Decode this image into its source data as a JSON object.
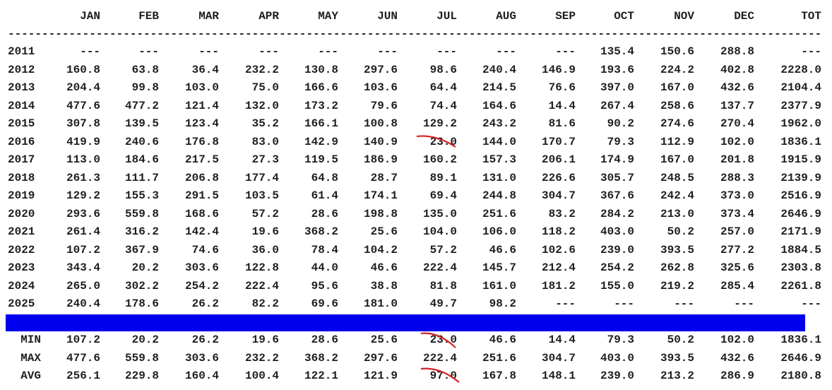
{
  "headers": [
    "JAN",
    "FEB",
    "MAR",
    "APR",
    "MAY",
    "JUN",
    "JUL",
    "AUG",
    "SEP",
    "OCT",
    "NOV",
    "DEC",
    "TOT"
  ],
  "separator": "------------------------------------------------------------------------------------------------------------------------------------------------------------",
  "rows": [
    {
      "year": "2011",
      "values": [
        "---",
        "---",
        "---",
        "---",
        "---",
        "---",
        "---",
        "---",
        "---",
        "135.4",
        "150.6",
        "288.8",
        "---"
      ]
    },
    {
      "year": "2012",
      "values": [
        "160.8",
        "63.8",
        "36.4",
        "232.2",
        "130.8",
        "297.6",
        "98.6",
        "240.4",
        "146.9",
        "193.6",
        "224.2",
        "402.8",
        "2228.0"
      ]
    },
    {
      "year": "2013",
      "values": [
        "204.4",
        "99.8",
        "103.0",
        "75.0",
        "166.6",
        "103.6",
        "64.4",
        "214.5",
        "76.6",
        "397.0",
        "167.0",
        "432.6",
        "2104.4"
      ]
    },
    {
      "year": "2014",
      "values": [
        "477.6",
        "477.2",
        "121.4",
        "132.0",
        "173.2",
        "79.6",
        "74.4",
        "164.6",
        "14.4",
        "267.4",
        "258.6",
        "137.7",
        "2377.9"
      ]
    },
    {
      "year": "2015",
      "values": [
        "307.8",
        "139.5",
        "123.4",
        "35.2",
        "166.1",
        "100.8",
        "129.2",
        "243.2",
        "81.6",
        "90.2",
        "274.6",
        "270.4",
        "1962.0"
      ]
    },
    {
      "year": "2016",
      "values": [
        "419.9",
        "240.6",
        "176.8",
        "83.0",
        "142.9",
        "140.9",
        "23.0",
        "144.0",
        "170.7",
        "79.3",
        "112.9",
        "102.0",
        "1836.1"
      ]
    },
    {
      "year": "2017",
      "values": [
        "113.0",
        "184.6",
        "217.5",
        "27.3",
        "119.5",
        "186.9",
        "160.2",
        "157.3",
        "206.1",
        "174.9",
        "167.0",
        "201.8",
        "1915.9"
      ]
    },
    {
      "year": "2018",
      "values": [
        "261.3",
        "111.7",
        "206.8",
        "177.4",
        "64.8",
        "28.7",
        "89.1",
        "131.0",
        "226.6",
        "305.7",
        "248.5",
        "288.3",
        "2139.9"
      ]
    },
    {
      "year": "2019",
      "values": [
        "129.2",
        "155.3",
        "291.5",
        "103.5",
        "61.4",
        "174.1",
        "69.4",
        "244.8",
        "304.7",
        "367.6",
        "242.4",
        "373.0",
        "2516.9"
      ]
    },
    {
      "year": "2020",
      "values": [
        "293.6",
        "559.8",
        "168.6",
        "57.2",
        "28.6",
        "198.8",
        "135.0",
        "251.6",
        "83.2",
        "284.2",
        "213.0",
        "373.4",
        "2646.9"
      ]
    },
    {
      "year": "2021",
      "values": [
        "261.4",
        "316.2",
        "142.4",
        "19.6",
        "368.2",
        "25.6",
        "104.0",
        "106.0",
        "118.2",
        "403.0",
        "50.2",
        "257.0",
        "2171.9"
      ]
    },
    {
      "year": "2022",
      "values": [
        "107.2",
        "367.9",
        "74.6",
        "36.0",
        "78.4",
        "104.2",
        "57.2",
        "46.6",
        "102.6",
        "239.0",
        "393.5",
        "277.2",
        "1884.5"
      ]
    },
    {
      "year": "2023",
      "values": [
        "343.4",
        "20.2",
        "303.6",
        "122.8",
        "44.0",
        "46.6",
        "222.4",
        "145.7",
        "212.4",
        "254.2",
        "262.8",
        "325.6",
        "2303.8"
      ]
    },
    {
      "year": "2024",
      "values": [
        "265.0",
        "302.2",
        "254.2",
        "222.4",
        "95.6",
        "38.8",
        "81.8",
        "161.0",
        "181.2",
        "155.0",
        "219.2",
        "285.4",
        "2261.8"
      ]
    },
    {
      "year": "2025",
      "values": [
        "240.4",
        "178.6",
        "26.2",
        "82.2",
        "69.6",
        "181.0",
        "49.7",
        "98.2",
        "---",
        "---",
        "---",
        "---",
        "---"
      ]
    }
  ],
  "stats": [
    {
      "label": "MIN",
      "values": [
        "107.2",
        "20.2",
        "26.2",
        "19.6",
        "28.6",
        "25.6",
        "23.0",
        "46.6",
        "14.4",
        "79.3",
        "50.2",
        "102.0",
        "1836.1"
      ]
    },
    {
      "label": "MAX",
      "values": [
        "477.6",
        "559.8",
        "303.6",
        "232.2",
        "368.2",
        "297.6",
        "222.4",
        "251.6",
        "304.7",
        "403.0",
        "393.5",
        "432.6",
        "2646.9"
      ]
    },
    {
      "label": "AVG",
      "values": [
        "256.1",
        "229.8",
        "160.4",
        "100.4",
        "122.1",
        "121.9",
        "97.0",
        "167.8",
        "148.1",
        "239.0",
        "213.2",
        "286.9",
        "2180.8"
      ]
    }
  ],
  "highlight_bar_color": "#0000ee",
  "strike_color": "#d42020"
}
